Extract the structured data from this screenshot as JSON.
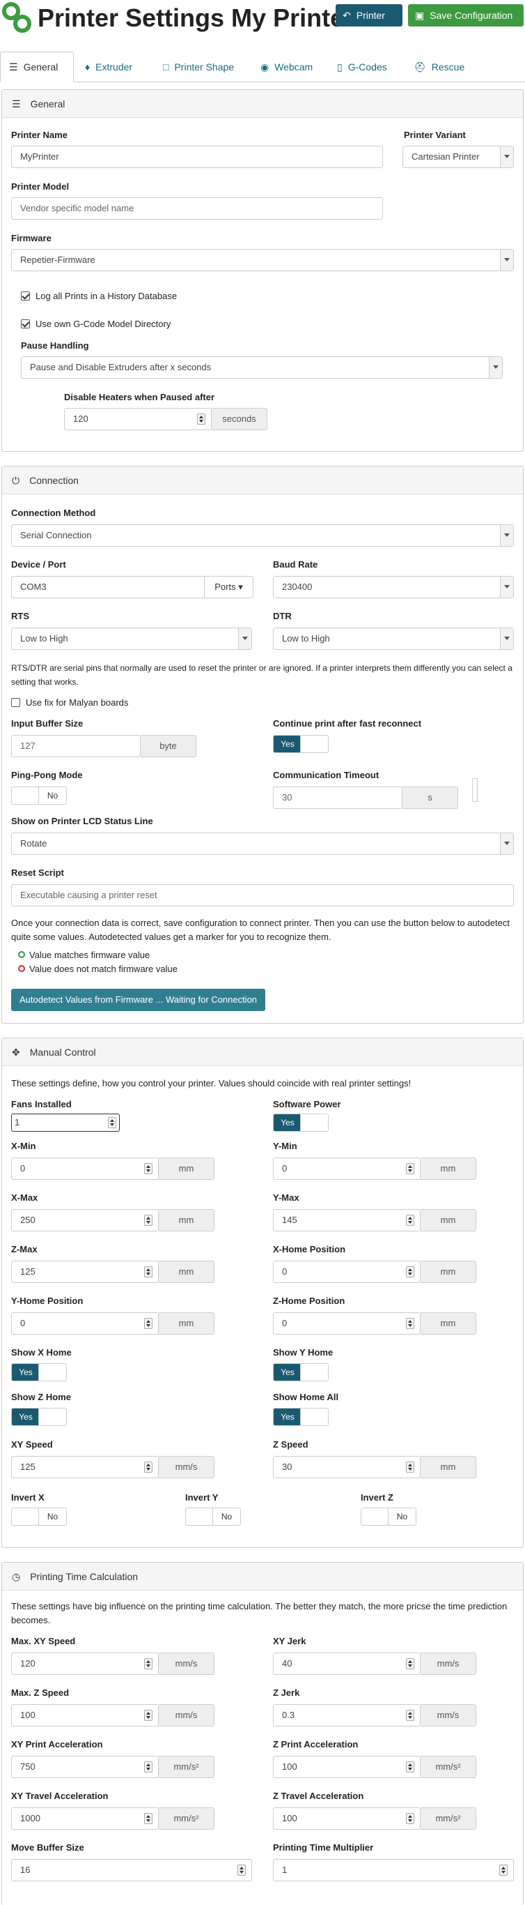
{
  "header": {
    "title": "Printer Settings My Printer",
    "printer_btn": "Printer",
    "save_btn": "Save Configuration"
  },
  "tabs": [
    "General",
    "Extruder",
    "Printer Shape",
    "Webcam",
    "G-Codes",
    "Rescue"
  ],
  "general": {
    "panel_title": "General",
    "printer_name_label": "Printer Name",
    "printer_name": "MyPrinter",
    "variant_label": "Printer Variant",
    "variant": "Cartesian Printer",
    "model_label": "Printer Model",
    "model_placeholder": "Vendor specific model name",
    "firmware_label": "Firmware",
    "firmware": "Repetier-Firmware",
    "log_prints": "Log all Prints in a History Database",
    "own_gcode_dir": "Use own G-Code Model Directory",
    "pause_label": "Pause Handling",
    "pause": "Pause and Disable Extruders after x seconds",
    "disable_heaters_label": "Disable Heaters when Paused after",
    "disable_heaters": "120",
    "disable_heaters_unit": "seconds"
  },
  "connection": {
    "panel_title": "Connection",
    "method_label": "Connection Method",
    "method": "Serial Connection",
    "port_label": "Device / Port",
    "port": "COM3",
    "ports_btn": "Ports",
    "baud_label": "Baud Rate",
    "baud": "230400",
    "rts_label": "RTS",
    "rts": "Low to High",
    "dtr_label": "DTR",
    "dtr": "Low to High",
    "rtsdtr_note": "RTS/DTR are serial pins that normally are used to reset the printer or are ignored. If a printer interprets them differently you can select a setting that works.",
    "malyan": "Use fix for Malyan boards",
    "buffer_label": "Input Buffer Size",
    "buffer": "127",
    "buffer_unit": "byte",
    "continue_label": "Continue print after fast reconnect",
    "continue_yes": "Yes",
    "pingpong_label": "Ping-Pong Mode",
    "pingpong_no": "No",
    "timeout_label": "Communication Timeout",
    "timeout": "30",
    "timeout_unit": "s",
    "lcd_label": "Show on Printer LCD Status Line",
    "lcd": "Rotate",
    "reset_label": "Reset Script",
    "reset_placeholder": "Executable causing a printer reset",
    "autodetect_note": "Once your connection data is correct, save configuration to connect printer. Then you can use the button below to autodetect quite some values. Autodetected values get a marker for you to recognize them.",
    "match": "Value matches firmware value",
    "nomatch": "Value does not match firmware value",
    "autodetect_btn": "Autodetect Values from Firmware ... Waiting for Connection"
  },
  "manual": {
    "panel_title": "Manual Control",
    "note": "These settings define, how you control your printer. Values should coincide with real printer settings!",
    "fans_label": "Fans Installed",
    "fans": "1",
    "power_label": "Software Power",
    "xmin_label": "X-Min",
    "xmin": "0",
    "ymin_label": "Y-Min",
    "ymin": "0",
    "xmax_label": "X-Max",
    "xmax": "250",
    "ymax_label": "Y-Max",
    "ymax": "145",
    "zmax_label": "Z-Max",
    "zmax": "125",
    "xhome_label": "X-Home Position",
    "xhome": "0",
    "yhome_label": "Y-Home Position",
    "yhome": "0",
    "zhome_label": "Z-Home Position",
    "zhome": "0",
    "unit_mm": "mm",
    "unit_mms": "mm/s",
    "showx_label": "Show X Home",
    "showy_label": "Show Y Home",
    "showz_label": "Show Z Home",
    "showall_label": "Show Home All",
    "xyspeed_label": "XY Speed",
    "xyspeed": "125",
    "zspeed_label": "Z Speed",
    "zspeed": "30",
    "invx_label": "Invert X",
    "invy_label": "Invert Y",
    "invz_label": "Invert Z",
    "yes": "Yes",
    "no": "No"
  },
  "timing": {
    "panel_title": "Printing Time Calculation",
    "note": "These settings have big influence on the printing time calculation. The better they match, the more pricse the time prediction becomes.",
    "maxxy_label": "Max. XY Speed",
    "maxxy": "120",
    "xyjerk_label": "XY Jerk",
    "xyjerk": "40",
    "maxz_label": "Max. Z Speed",
    "maxz": "100",
    "zjerk_label": "Z Jerk",
    "zjerk": "0.3",
    "xyacc_label": "XY Print Acceleration",
    "xyacc": "750",
    "zacc_label": "Z Print Acceleration",
    "zacc": "100",
    "xytravel_label": "XY Travel Acceleration",
    "xytravel": "1000",
    "ztravel_label": "Z Travel Acceleration",
    "ztravel": "100",
    "movebuf_label": "Move Buffer Size",
    "movebuf": "16",
    "mult_label": "Printing Time Multiplier",
    "mult": "1",
    "unit_mms": "mm/s",
    "unit_mms2": "mm/s²"
  },
  "colors": {
    "dark_teal": "#1a5a70",
    "green": "#3d9a40",
    "teal_btn": "#2e8090"
  }
}
